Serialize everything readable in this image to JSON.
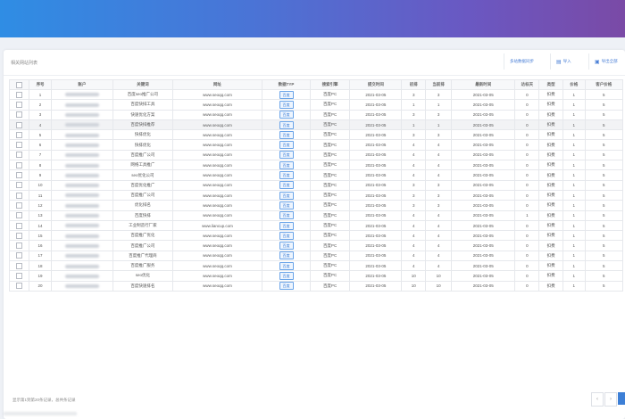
{
  "toolbar": {
    "title": "相关网站列表",
    "btn_a_label": "多站数据同步",
    "btn_b_label": "导入",
    "btn_c_label": "导出全部"
  },
  "table": {
    "headers": [
      "序号",
      "账户",
      "关键词",
      "网址",
      "数据TYP",
      "搜索引擎",
      "提交时间",
      "初排",
      "当前排",
      "最新时间",
      "达标天",
      "类型",
      "价格",
      "客户价格"
    ],
    "rows": [
      {
        "no": "1",
        "kw": "百度seo推广公司",
        "url": "www.seoqq.com",
        "engine": "百度PC",
        "date": "2021-03-05",
        "r1": "3",
        "r2": "3",
        "last": "2021-03-05",
        "days": "0",
        "type": "扣费",
        "price": "1",
        "cprice": "5"
      },
      {
        "no": "2",
        "kw": "百度快排工具",
        "url": "www.seoqq.com",
        "engine": "百度PC",
        "date": "2021-03-05",
        "r1": "1",
        "r2": "1",
        "last": "2021-03-05",
        "days": "0",
        "type": "扣费",
        "price": "1",
        "cprice": "5"
      },
      {
        "no": "3",
        "kw": "快速优化方案",
        "url": "www.seoqq.com",
        "engine": "百度PC",
        "date": "2021-03-05",
        "r1": "3",
        "r2": "3",
        "last": "2021-03-05",
        "days": "0",
        "type": "扣费",
        "price": "1",
        "cprice": "5"
      },
      {
        "no": "4",
        "kw": "百度快排推荐",
        "url": "www.seoqq.com",
        "engine": "百度PC",
        "date": "2021-03-05",
        "r1": "1",
        "r2": "1",
        "last": "2021-03-05",
        "days": "0",
        "type": "扣费",
        "price": "1",
        "cprice": "5"
      },
      {
        "no": "5",
        "kw": "快排优化",
        "url": "www.seoqq.com",
        "engine": "百度PC",
        "date": "2021-03-05",
        "r1": "3",
        "r2": "3",
        "last": "2021-03-05",
        "days": "0",
        "type": "扣费",
        "price": "1",
        "cprice": "5"
      },
      {
        "no": "6",
        "kw": "快排优化",
        "url": "www.seoqq.com",
        "engine": "百度PC",
        "date": "2021-03-05",
        "r1": "4",
        "r2": "4",
        "last": "2021-03-05",
        "days": "0",
        "type": "扣费",
        "price": "1",
        "cprice": "5"
      },
      {
        "no": "7",
        "kw": "百度推广公司",
        "url": "www.seoqq.com",
        "engine": "百度PC",
        "date": "2021-03-05",
        "r1": "4",
        "r2": "4",
        "last": "2021-03-05",
        "days": "0",
        "type": "扣费",
        "price": "1",
        "cprice": "5"
      },
      {
        "no": "8",
        "kw": "网络工具推广",
        "url": "www.seoqq.com",
        "engine": "百度PC",
        "date": "2021-03-05",
        "r1": "4",
        "r2": "4",
        "last": "2021-03-05",
        "days": "0",
        "type": "扣费",
        "price": "1",
        "cprice": "5"
      },
      {
        "no": "9",
        "kw": "seo优化公司",
        "url": "www.seoqq.com",
        "engine": "百度PC",
        "date": "2021-03-05",
        "r1": "4",
        "r2": "4",
        "last": "2021-03-05",
        "days": "0",
        "type": "扣费",
        "price": "1",
        "cprice": "5"
      },
      {
        "no": "10",
        "kw": "百度优化推广",
        "url": "www.seoqq.com",
        "engine": "百度PC",
        "date": "2021-03-05",
        "r1": "3",
        "r2": "3",
        "last": "2021-03-05",
        "days": "0",
        "type": "扣费",
        "price": "1",
        "cprice": "5"
      },
      {
        "no": "11",
        "kw": "百度推广公司",
        "url": "www.seoqq.com",
        "engine": "百度PC",
        "date": "2021-03-05",
        "r1": "3",
        "r2": "3",
        "last": "2021-03-05",
        "days": "0",
        "type": "扣费",
        "price": "1",
        "cprice": "5"
      },
      {
        "no": "12",
        "kw": "优化排名",
        "url": "www.seoqq.com",
        "engine": "百度PC",
        "date": "2021-03-05",
        "r1": "3",
        "r2": "3",
        "last": "2021-03-05",
        "days": "0",
        "type": "扣费",
        "price": "1",
        "cprice": "5"
      },
      {
        "no": "13",
        "kw": "百度快排",
        "url": "www.seoqq.com",
        "engine": "百度PC",
        "date": "2021-03-05",
        "r1": "4",
        "r2": "4",
        "last": "2021-03-05",
        "days": "1",
        "type": "扣费",
        "price": "1",
        "cprice": "5"
      },
      {
        "no": "14",
        "kw": "工业制造行厂家",
        "url": "www.liancup.com",
        "engine": "百度PC",
        "date": "2021-03-05",
        "r1": "4",
        "r2": "4",
        "last": "2021-03-05",
        "days": "0",
        "type": "扣费",
        "price": "1",
        "cprice": "5"
      },
      {
        "no": "15",
        "kw": "百度推广优化",
        "url": "www.seoqq.com",
        "engine": "百度PC",
        "date": "2021-03-05",
        "r1": "4",
        "r2": "4",
        "last": "2021-03-05",
        "days": "0",
        "type": "扣费",
        "price": "1",
        "cprice": "5"
      },
      {
        "no": "16",
        "kw": "百度推广公司",
        "url": "www.seoqq.com",
        "engine": "百度PC",
        "date": "2021-03-05",
        "r1": "4",
        "r2": "4",
        "last": "2021-03-05",
        "days": "0",
        "type": "扣费",
        "price": "1",
        "cprice": "5"
      },
      {
        "no": "17",
        "kw": "百度推广代理商",
        "url": "www.seoqq.com",
        "engine": "百度PC",
        "date": "2021-03-05",
        "r1": "4",
        "r2": "4",
        "last": "2021-03-05",
        "days": "0",
        "type": "扣费",
        "price": "1",
        "cprice": "5"
      },
      {
        "no": "18",
        "kw": "百度推广服务",
        "url": "www.seoqq.com",
        "engine": "百度PC",
        "date": "2021-03-05",
        "r1": "4",
        "r2": "4",
        "last": "2021-03-05",
        "days": "0",
        "type": "扣费",
        "price": "1",
        "cprice": "5"
      },
      {
        "no": "19",
        "kw": "seo优化",
        "url": "www.seoqq.com",
        "engine": "百度PC",
        "date": "2021-03-05",
        "r1": "10",
        "r2": "10",
        "last": "2021-03-05",
        "days": "0",
        "type": "扣费",
        "price": "1",
        "cprice": "5"
      },
      {
        "no": "20",
        "kw": "百度快速排名",
        "url": "www.seoqq.com",
        "engine": "百度PC",
        "date": "2021-03-05",
        "r1": "10",
        "r2": "10",
        "last": "2021-03-05",
        "days": "0",
        "type": "扣费",
        "price": "1",
        "cprice": "5"
      }
    ],
    "data_type_label": "百度"
  },
  "footer": {
    "summary": "显示第1到第20条记录，总共条记录"
  },
  "colors": {
    "accent": "#3d7fd6",
    "banner_start": "#2f8de4",
    "banner_end": "#7a4aa6"
  }
}
